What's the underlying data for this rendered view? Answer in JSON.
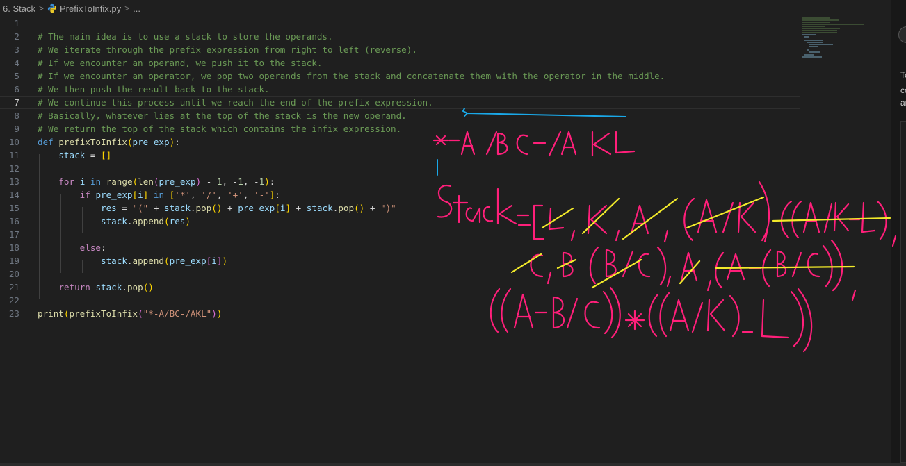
{
  "breadcrumb": {
    "folder": "6. Stack",
    "file": "PrefixToInfix.py",
    "symbol": "..."
  },
  "editor": {
    "active_line": 7,
    "lines": [
      {
        "n": "1"
      },
      {
        "n": "2",
        "t": [
          {
            "c": "cm",
            "v": "# The main idea is to use a stack to store the operands."
          }
        ]
      },
      {
        "n": "3",
        "t": [
          {
            "c": "cm",
            "v": "# We iterate through the prefix expression from right to left (reverse)."
          }
        ]
      },
      {
        "n": "4",
        "t": [
          {
            "c": "cm",
            "v": "# If we encounter an operand, we push it to the stack."
          }
        ]
      },
      {
        "n": "5",
        "t": [
          {
            "c": "cm",
            "v": "# If we encounter an operator, we pop two operands from the stack and concatenate them with the operator in the middle."
          }
        ]
      },
      {
        "n": "6",
        "t": [
          {
            "c": "cm",
            "v": "# We then push the result back to the stack."
          }
        ]
      },
      {
        "n": "7",
        "t": [
          {
            "c": "cm",
            "v": "# We continue this process until we reach the end of the prefix expression."
          }
        ]
      },
      {
        "n": "8",
        "t": [
          {
            "c": "cm",
            "v": "# Basically, whatever lies at the top of the stack is the new operand."
          }
        ]
      },
      {
        "n": "9",
        "t": [
          {
            "c": "cm",
            "v": "# We return the top of the stack which contains the infix expression."
          }
        ]
      },
      {
        "n": "10",
        "t": [
          {
            "c": "kw",
            "v": "def "
          },
          {
            "c": "fn",
            "v": "prefixToInfix"
          },
          {
            "c": "br1",
            "v": "("
          },
          {
            "c": "var",
            "v": "pre_exp"
          },
          {
            "c": "br1",
            "v": ")"
          },
          {
            "c": "op",
            "v": ":"
          }
        ]
      },
      {
        "n": "11",
        "t": [
          {
            "c": "op",
            "v": "    "
          },
          {
            "c": "var",
            "v": "stack"
          },
          {
            "c": "op",
            "v": " = "
          },
          {
            "c": "br1",
            "v": "[]"
          }
        ]
      },
      {
        "n": "12"
      },
      {
        "n": "13",
        "t": [
          {
            "c": "op",
            "v": "    "
          },
          {
            "c": "ctl",
            "v": "for"
          },
          {
            "c": "op",
            "v": " "
          },
          {
            "c": "var",
            "v": "i"
          },
          {
            "c": "op",
            "v": " "
          },
          {
            "c": "kw",
            "v": "in"
          },
          {
            "c": "op",
            "v": " "
          },
          {
            "c": "fn",
            "v": "range"
          },
          {
            "c": "br1",
            "v": "("
          },
          {
            "c": "fn",
            "v": "len"
          },
          {
            "c": "br2",
            "v": "("
          },
          {
            "c": "var",
            "v": "pre_exp"
          },
          {
            "c": "br2",
            "v": ")"
          },
          {
            "c": "op",
            "v": " - "
          },
          {
            "c": "num",
            "v": "1"
          },
          {
            "c": "op",
            "v": ", -"
          },
          {
            "c": "num",
            "v": "1"
          },
          {
            "c": "op",
            "v": ", -"
          },
          {
            "c": "num",
            "v": "1"
          },
          {
            "c": "br1",
            "v": ")"
          },
          {
            "c": "op",
            "v": ":"
          }
        ]
      },
      {
        "n": "14",
        "t": [
          {
            "c": "op",
            "v": "        "
          },
          {
            "c": "ctl",
            "v": "if"
          },
          {
            "c": "op",
            "v": " "
          },
          {
            "c": "var",
            "v": "pre_exp"
          },
          {
            "c": "br1",
            "v": "["
          },
          {
            "c": "var",
            "v": "i"
          },
          {
            "c": "br1",
            "v": "]"
          },
          {
            "c": "op",
            "v": " "
          },
          {
            "c": "kw",
            "v": "in"
          },
          {
            "c": "op",
            "v": " "
          },
          {
            "c": "br1",
            "v": "["
          },
          {
            "c": "str",
            "v": "'*'"
          },
          {
            "c": "op",
            "v": ", "
          },
          {
            "c": "str",
            "v": "'/'"
          },
          {
            "c": "op",
            "v": ", "
          },
          {
            "c": "str",
            "v": "'+'"
          },
          {
            "c": "op",
            "v": ", "
          },
          {
            "c": "str",
            "v": "'-'"
          },
          {
            "c": "br1",
            "v": "]"
          },
          {
            "c": "op",
            "v": ":"
          }
        ]
      },
      {
        "n": "15",
        "t": [
          {
            "c": "op",
            "v": "            "
          },
          {
            "c": "var",
            "v": "res"
          },
          {
            "c": "op",
            "v": " = "
          },
          {
            "c": "str",
            "v": "\"(\""
          },
          {
            "c": "op",
            "v": " + "
          },
          {
            "c": "var",
            "v": "stack"
          },
          {
            "c": "op",
            "v": "."
          },
          {
            "c": "fn",
            "v": "pop"
          },
          {
            "c": "br1",
            "v": "()"
          },
          {
            "c": "op",
            "v": " + "
          },
          {
            "c": "var",
            "v": "pre_exp"
          },
          {
            "c": "br1",
            "v": "["
          },
          {
            "c": "var",
            "v": "i"
          },
          {
            "c": "br1",
            "v": "]"
          },
          {
            "c": "op",
            "v": " + "
          },
          {
            "c": "var",
            "v": "stack"
          },
          {
            "c": "op",
            "v": "."
          },
          {
            "c": "fn",
            "v": "pop"
          },
          {
            "c": "br1",
            "v": "()"
          },
          {
            "c": "op",
            "v": " + "
          },
          {
            "c": "str",
            "v": "\")\""
          }
        ]
      },
      {
        "n": "16",
        "t": [
          {
            "c": "op",
            "v": "            "
          },
          {
            "c": "var",
            "v": "stack"
          },
          {
            "c": "op",
            "v": "."
          },
          {
            "c": "fn",
            "v": "append"
          },
          {
            "c": "br1",
            "v": "("
          },
          {
            "c": "var",
            "v": "res"
          },
          {
            "c": "br1",
            "v": ")"
          }
        ]
      },
      {
        "n": "17"
      },
      {
        "n": "18",
        "t": [
          {
            "c": "op",
            "v": "        "
          },
          {
            "c": "ctl",
            "v": "else"
          },
          {
            "c": "op",
            "v": ":"
          }
        ]
      },
      {
        "n": "19",
        "t": [
          {
            "c": "op",
            "v": "            "
          },
          {
            "c": "var",
            "v": "stack"
          },
          {
            "c": "op",
            "v": "."
          },
          {
            "c": "fn",
            "v": "append"
          },
          {
            "c": "br1",
            "v": "("
          },
          {
            "c": "var",
            "v": "pre_exp"
          },
          {
            "c": "br2",
            "v": "["
          },
          {
            "c": "var",
            "v": "i"
          },
          {
            "c": "br2",
            "v": "]"
          },
          {
            "c": "br1",
            "v": ")"
          }
        ]
      },
      {
        "n": "20"
      },
      {
        "n": "21",
        "t": [
          {
            "c": "op",
            "v": "    "
          },
          {
            "c": "ctl",
            "v": "return"
          },
          {
            "c": "op",
            "v": " "
          },
          {
            "c": "var",
            "v": "stack"
          },
          {
            "c": "op",
            "v": "."
          },
          {
            "c": "fn",
            "v": "pop"
          },
          {
            "c": "br1",
            "v": "()"
          }
        ]
      },
      {
        "n": "22"
      },
      {
        "n": "23",
        "t": [
          {
            "c": "fn",
            "v": "print"
          },
          {
            "c": "br1",
            "v": "("
          },
          {
            "c": "fn",
            "v": "prefixToInfix"
          },
          {
            "c": "br2",
            "v": "("
          },
          {
            "c": "str",
            "v": "\"*-A/BC-/AKL\""
          },
          {
            "c": "br2",
            "v": ")"
          },
          {
            "c": "br1",
            "v": ")"
          }
        ]
      }
    ]
  },
  "right_panel": {
    "snippets": [
      "To",
      "co",
      "ar"
    ]
  },
  "colors": {
    "background": "#1f1f1f",
    "ink_pink": "#ff1f7a",
    "ink_yellow": "#f2ea2a",
    "ink_blue": "#1aa8e8"
  }
}
